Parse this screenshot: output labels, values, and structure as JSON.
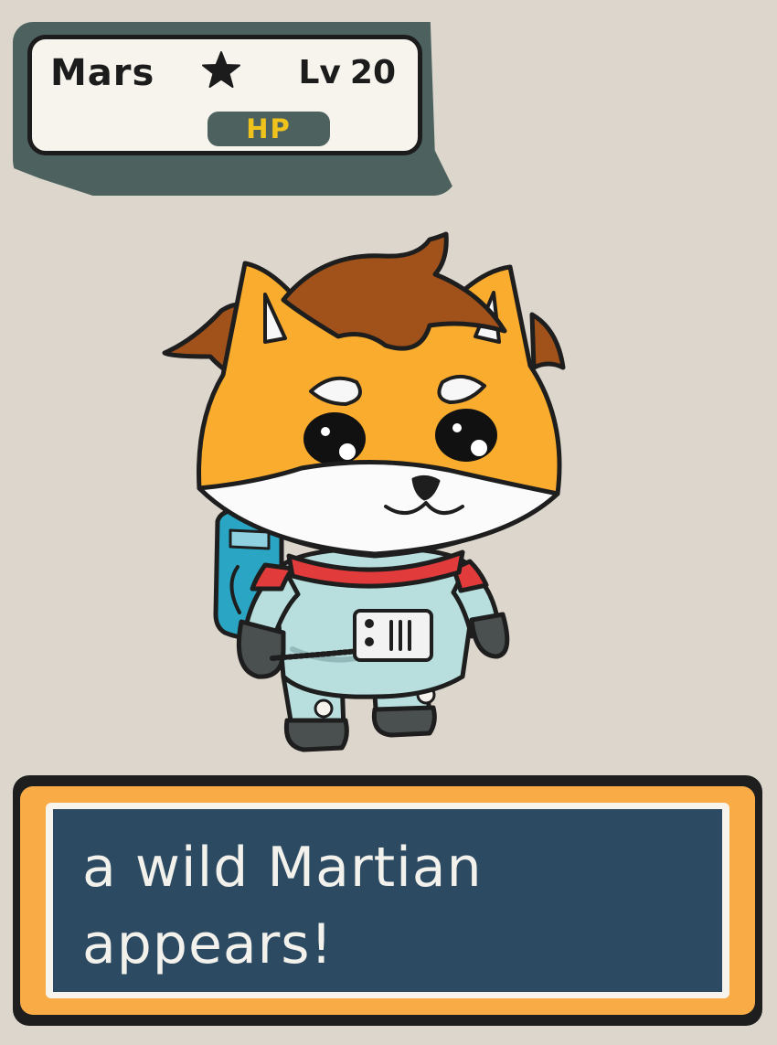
{
  "status": {
    "name": "Mars",
    "star_icon": "star-icon",
    "level_prefix": "Lv",
    "level_value": "20",
    "hp_label": "HP"
  },
  "sprite": {
    "icon": "fox-astronaut-sprite"
  },
  "dialog": {
    "line1": "a wild Martian",
    "line2": "appears!"
  },
  "colors": {
    "background": "#dcd6cc",
    "panel_accent": "#4d625f",
    "hp_text": "#f0c31c",
    "dialog_frame": "#f9ac46",
    "dialog_bg": "#2c4a62"
  }
}
